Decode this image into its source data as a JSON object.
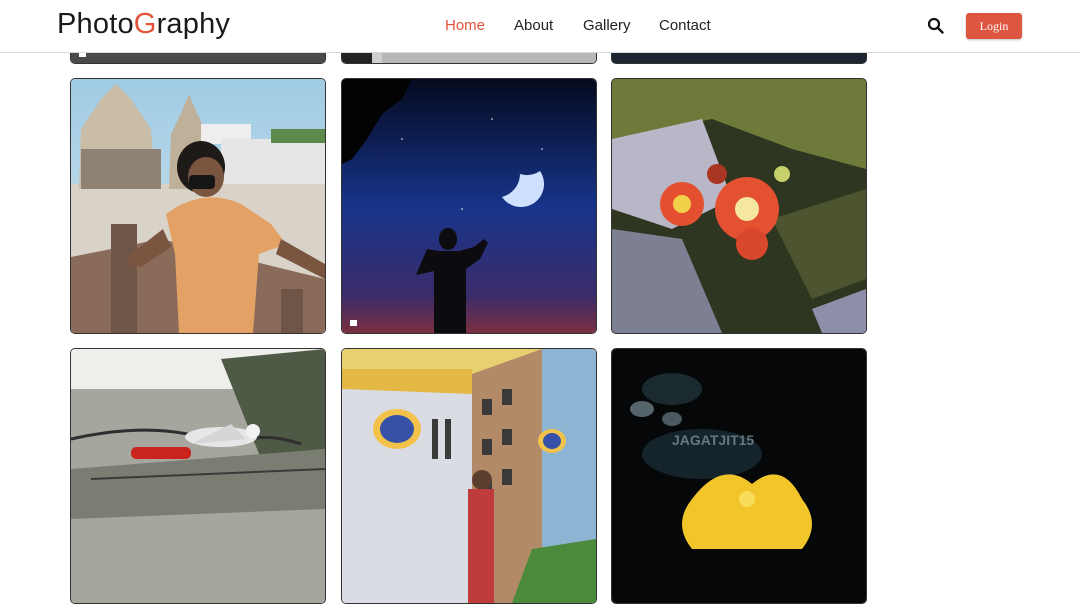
{
  "brand": {
    "part1": "Photo",
    "accent": "G",
    "part2": "raphy",
    "accent_color": "#e35239"
  },
  "nav": {
    "items": [
      {
        "label": "Home",
        "active": true
      },
      {
        "label": "About",
        "active": false
      },
      {
        "label": "Gallery",
        "active": false
      },
      {
        "label": "Contact",
        "active": false
      }
    ]
  },
  "search": {
    "icon": "search-icon"
  },
  "login": {
    "label": "Login",
    "color": "#de5540"
  },
  "gallery": {
    "photos": [
      {
        "name": "temple-portrait-photo"
      },
      {
        "name": "moon-silhouette-photo"
      },
      {
        "name": "red-flowers-photo"
      },
      {
        "name": "bird-on-branch-photo"
      },
      {
        "name": "building-portrait-photo"
      },
      {
        "name": "yellow-flower-photo",
        "watermark": "JAGATJIT15"
      }
    ]
  }
}
